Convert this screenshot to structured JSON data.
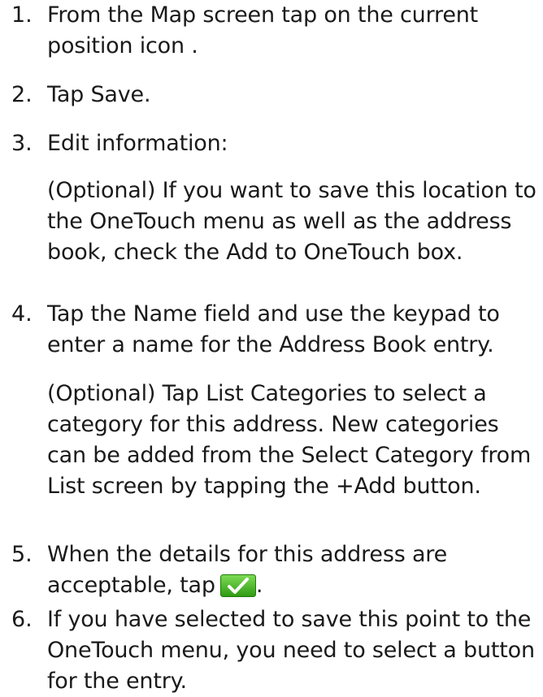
{
  "steps": [
    {
      "number": "1.",
      "text": "From the Map screen tap on the current position icon ."
    },
    {
      "number": "2.",
      "text": "Tap Save."
    },
    {
      "number": "3.",
      "text": "Edit information:",
      "note": "(Optional) If you want to save this location to the OneTouch menu as well as the address book, check the Add to OneTouch box."
    },
    {
      "number": "4.",
      "text": "Tap the Name field and use the keypad to enter a name for the Address Book entry.",
      "note": "(Optional) Tap List Categories to select a category for this address.  New categories can be added from the Select Category from List screen by tapping the +Add button."
    },
    {
      "number": "5.",
      "text_before_icon": "When the details for this address are acceptable, tap",
      "text_after_icon": ".",
      "icon": "checkmark-icon",
      "icon_color": "#3cb11c"
    },
    {
      "number": "6.",
      "text": "If you have selected to save this point to the OneTouch menu, you need to select a button for the entry."
    }
  ]
}
